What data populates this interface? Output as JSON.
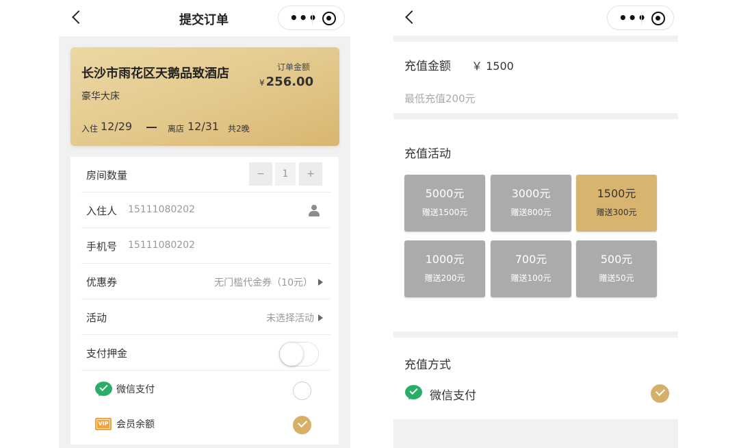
{
  "left": {
    "nav": {
      "title": "提交订单"
    },
    "card": {
      "hotel_name": "长沙市雨花区天鹅品致酒店",
      "room_type": "豪华大床",
      "amount_label": "订单金额",
      "currency": "¥",
      "amount": "256.00",
      "checkin_label": "入住",
      "checkin_date": "12/29",
      "checkout_label": "离店",
      "checkout_date": "12/31",
      "nights": "共2晚"
    },
    "form": {
      "room_count_label": "房间数量",
      "minus": "−",
      "room_count": "1",
      "plus": "+",
      "guest_label": "入住人",
      "guest_value": "15111080202",
      "phone_label": "手机号",
      "phone_value": "15111080202",
      "coupon_label": "优惠券",
      "coupon_value": "无门槛代金券（10元）",
      "activity_label": "活动",
      "activity_value": "未选择活动",
      "deposit_label": "支付押金",
      "deposit_enabled": false,
      "pay_options": [
        {
          "label": "微信支付",
          "icon": "wechat-pay-icon",
          "selected": false
        },
        {
          "label": "会员余额",
          "icon": "vip-icon",
          "vip_text": "VIP",
          "selected": true
        }
      ]
    }
  },
  "right": {
    "recharge_label": "充值金额",
    "recharge_value": "￥ 1500",
    "min_hint": "最低充值200元",
    "activity_title": "充值活动",
    "packages": [
      {
        "amount": "5000元",
        "bonus": "赠送1500元",
        "active": false
      },
      {
        "amount": "3000元",
        "bonus": "赠送800元",
        "active": false
      },
      {
        "amount": "1500元",
        "bonus": "赠送300元",
        "active": true
      },
      {
        "amount": "1000元",
        "bonus": "赠送200元",
        "active": false
      },
      {
        "amount": "700元",
        "bonus": "赠送100元",
        "active": false
      },
      {
        "amount": "500元",
        "bonus": "赠送50元",
        "active": false
      }
    ],
    "method_title": "充值方式",
    "method_option": {
      "label": "微信支付",
      "icon": "wechat-pay-icon",
      "selected": true
    }
  },
  "colors": {
    "gold": "#d4b069",
    "tile_gray": "#ababab",
    "tile_active": "#d9b46e",
    "wechat_green": "#2aae67",
    "vip_orange": "#f2a33a",
    "panel_bg": "#f1f1f1"
  }
}
